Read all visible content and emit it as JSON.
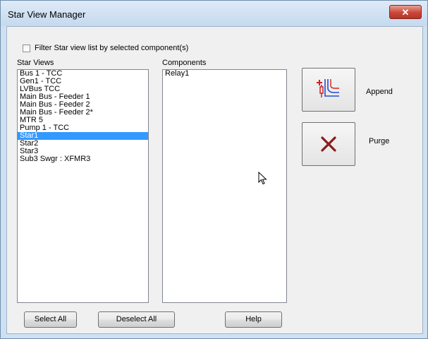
{
  "window": {
    "title": "Star View Manager",
    "close_glyph": "✕"
  },
  "filter": {
    "label": "Filter Star view list by selected component(s)",
    "checked": false
  },
  "star_views": {
    "header": "Star Views",
    "items": [
      "Bus 1 - TCC",
      "Gen1 - TCC",
      "LVBus TCC",
      "Main Bus - Feeder 1",
      "Main Bus - Feeder 2",
      "Main Bus - Feeder 2*",
      "MTR 5",
      "Pump 1 - TCC",
      "Star1",
      "Star2",
      "Star3",
      "Sub3 Swgr : XFMR3"
    ],
    "selected": "Star1"
  },
  "components": {
    "header": "Components",
    "items": [
      "Relay1"
    ]
  },
  "actions": {
    "append_label": "Append",
    "purge_label": "Purge"
  },
  "buttons": {
    "select_all": "Select All",
    "deselect_all": "Deselect All",
    "help": "Help"
  },
  "colors": {
    "selection": "#3399ff",
    "purge_x": "#8b1a1a",
    "append_icon_red": "#d42020",
    "append_icon_blue": "#1f4fd1"
  }
}
